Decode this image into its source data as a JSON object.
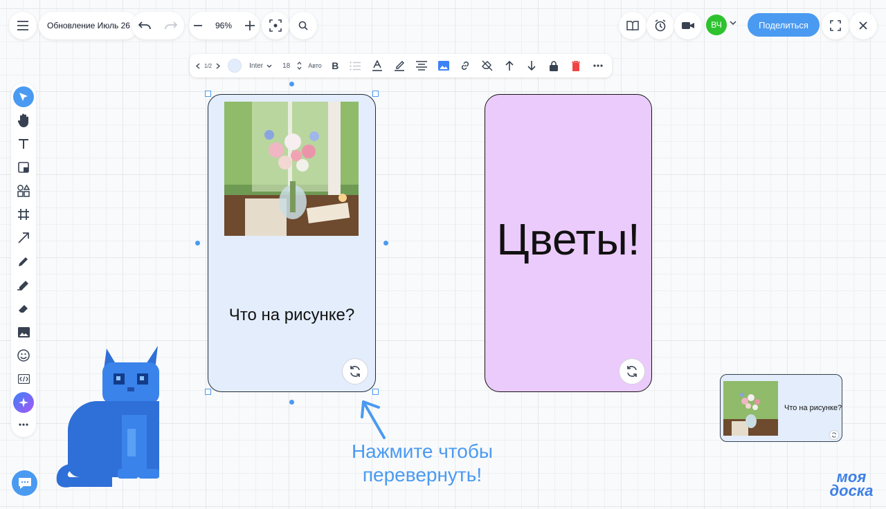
{
  "header": {
    "board_title": "Обновление Июль 26",
    "zoom": "96%",
    "share_label": "Поделиться",
    "avatar_initials": "ВЧ"
  },
  "format_toolbar": {
    "page": "1/2",
    "font": "Inter",
    "font_size": "18",
    "auto_label": "Авто",
    "bold_label": "B"
  },
  "cards": {
    "front_question": "Что на рисунке?",
    "back_text": "Цветы!"
  },
  "mini_preview": {
    "question": "Что на рисунке?"
  },
  "hint": {
    "line1": "Нажмите чтобы",
    "line2": "перевернуть!"
  },
  "logo": {
    "line1": "моя",
    "line2": "доска"
  },
  "colors": {
    "accent": "#4a9af1",
    "avatar_bg": "#2ec22f",
    "card_front_bg": "#e3edfb",
    "card_back_bg": "#ebcbfb",
    "cat": "#2f6fd8",
    "delete": "#ef4444"
  }
}
